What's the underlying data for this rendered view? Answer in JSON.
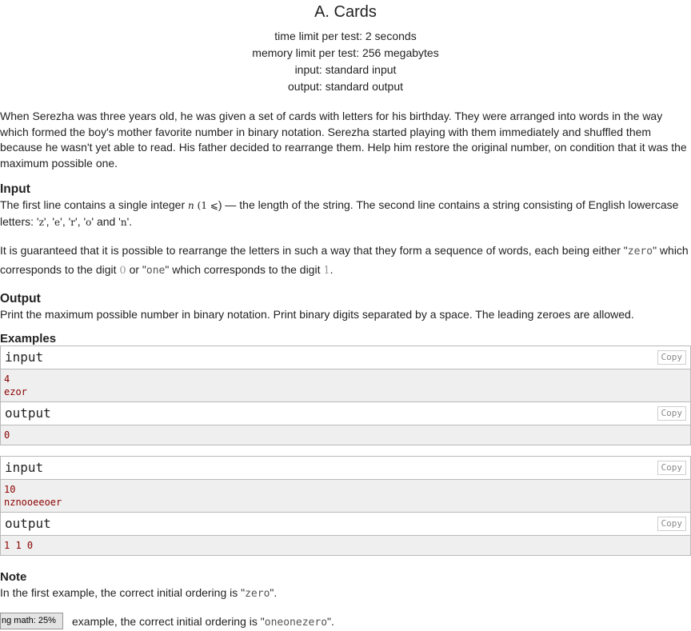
{
  "problem": {
    "title": "A. Cards",
    "time_limit": "time limit per test: 2 seconds",
    "memory_limit": "memory limit per test: 256 megabytes",
    "input_file": "input: standard input",
    "output_file": "output: standard output"
  },
  "statement": "When Serezha was three years old, he was given a set of cards with letters for his birthday. They were arranged into words in the way which formed the boy's mother favorite number in binary notation. Serezha started playing with them immediately and shuffled them because he wasn't yet able to read. His father decided to rearrange them. Help him restore the original number, on condition that it was the maximum possible one.",
  "input_section": {
    "title": "Input",
    "p1_a": "The first line contains a single integer ",
    "p1_var": "n",
    "p1_math": "(1 ⩽",
    "p1_b": ") — the length of the string. The second line contains a string consisting of English lowercase letters: '",
    "letters": [
      "z",
      "e",
      "r",
      "o",
      "n"
    ],
    "p2_a": "It is guaranteed that it is possible to rearrange the letters in such a way that they form a sequence of words, each being either \"",
    "word_zero": "zero",
    "p2_b": "\" which corresponds to the digit ",
    "digit_zero": "0",
    "p2_c": " or \"",
    "word_one": "one",
    "p2_d": "\" which corresponds to the digit ",
    "digit_one": "1",
    "p2_e": "."
  },
  "output_section": {
    "title": "Output",
    "text": "Print the maximum possible number in binary notation. Print binary digits separated by a space. The leading zeroes are allowed."
  },
  "examples": {
    "title": "Examples",
    "copy_label": "Copy",
    "input_label": "input",
    "output_label": "output",
    "tests": [
      {
        "input": [
          "4",
          "ezor"
        ],
        "output": [
          "0"
        ]
      },
      {
        "input": [
          "10",
          "nznooeeoer"
        ],
        "output": [
          "1 1 0"
        ]
      }
    ]
  },
  "note": {
    "title": "Note",
    "line1_a": "In the first example, the correct initial ordering is \"",
    "line1_word": "zero",
    "line1_b": "\".",
    "line2_a": "example, the correct initial ordering is \"",
    "line2_word": "oneonezero",
    "line2_b": "\"."
  },
  "mathjax_status": "ng math: 25%"
}
